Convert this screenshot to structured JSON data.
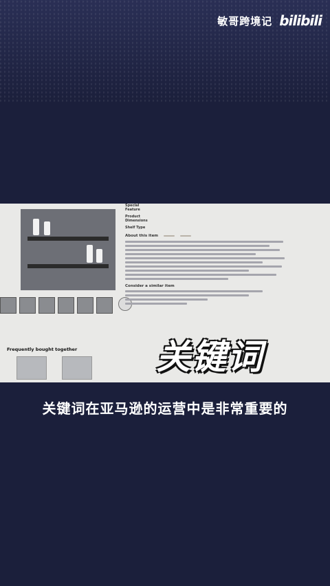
{
  "channel": {
    "name": "敏哥跨境记",
    "logo": "bilibili"
  },
  "product": {
    "meta": [
      {
        "key": "Special Feature",
        "value": ""
      },
      {
        "key": "Product Dimensions",
        "value": ""
      },
      {
        "key": "Shelf Type",
        "value": ""
      }
    ],
    "about_title": "About this item",
    "similar_title": "Consider a similar item",
    "fbt_title": "Frequently bought together"
  },
  "overlay_keyword": "关键词",
  "subtitle": "关键词在亚马逊的运营中是非常重要的"
}
